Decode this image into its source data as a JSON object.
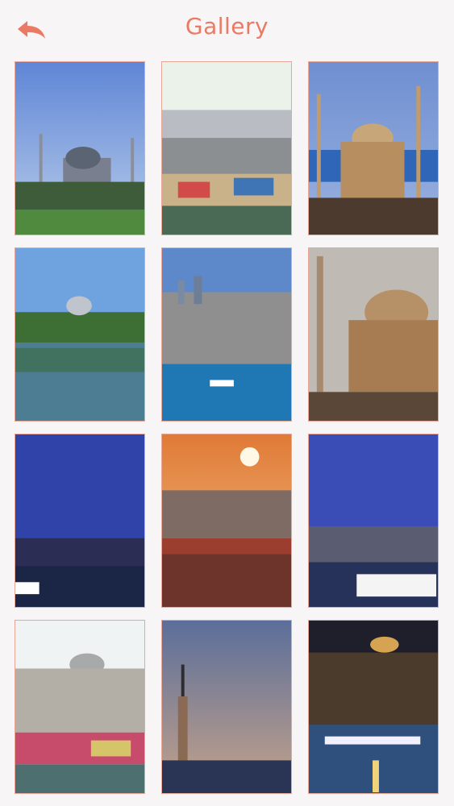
{
  "header": {
    "title": "Gallery",
    "back_icon": "back-arrow-icon"
  },
  "colors": {
    "accent": "#ea7a63",
    "background": "#f7f5f6",
    "tile_border": "#e9a596"
  },
  "gallery": {
    "columns": 3,
    "rows": 4,
    "photos": [
      {
        "subject": "hagia-sophia-photo"
      },
      {
        "subject": "harbor-boats-photo"
      },
      {
        "subject": "blue-mosque-photo"
      },
      {
        "subject": "mosque-reflection-photo"
      },
      {
        "subject": "bosphorus-skyline-photo"
      },
      {
        "subject": "mosque-dome-sunset-photo"
      },
      {
        "subject": "night-bridge-photo"
      },
      {
        "subject": "city-sunset-rooftops-photo"
      },
      {
        "subject": "galata-tower-night-photo"
      },
      {
        "subject": "mosque-harbor-photo"
      },
      {
        "subject": "maidens-tower-photo"
      },
      {
        "subject": "city-night-lights-photo"
      }
    ]
  }
}
